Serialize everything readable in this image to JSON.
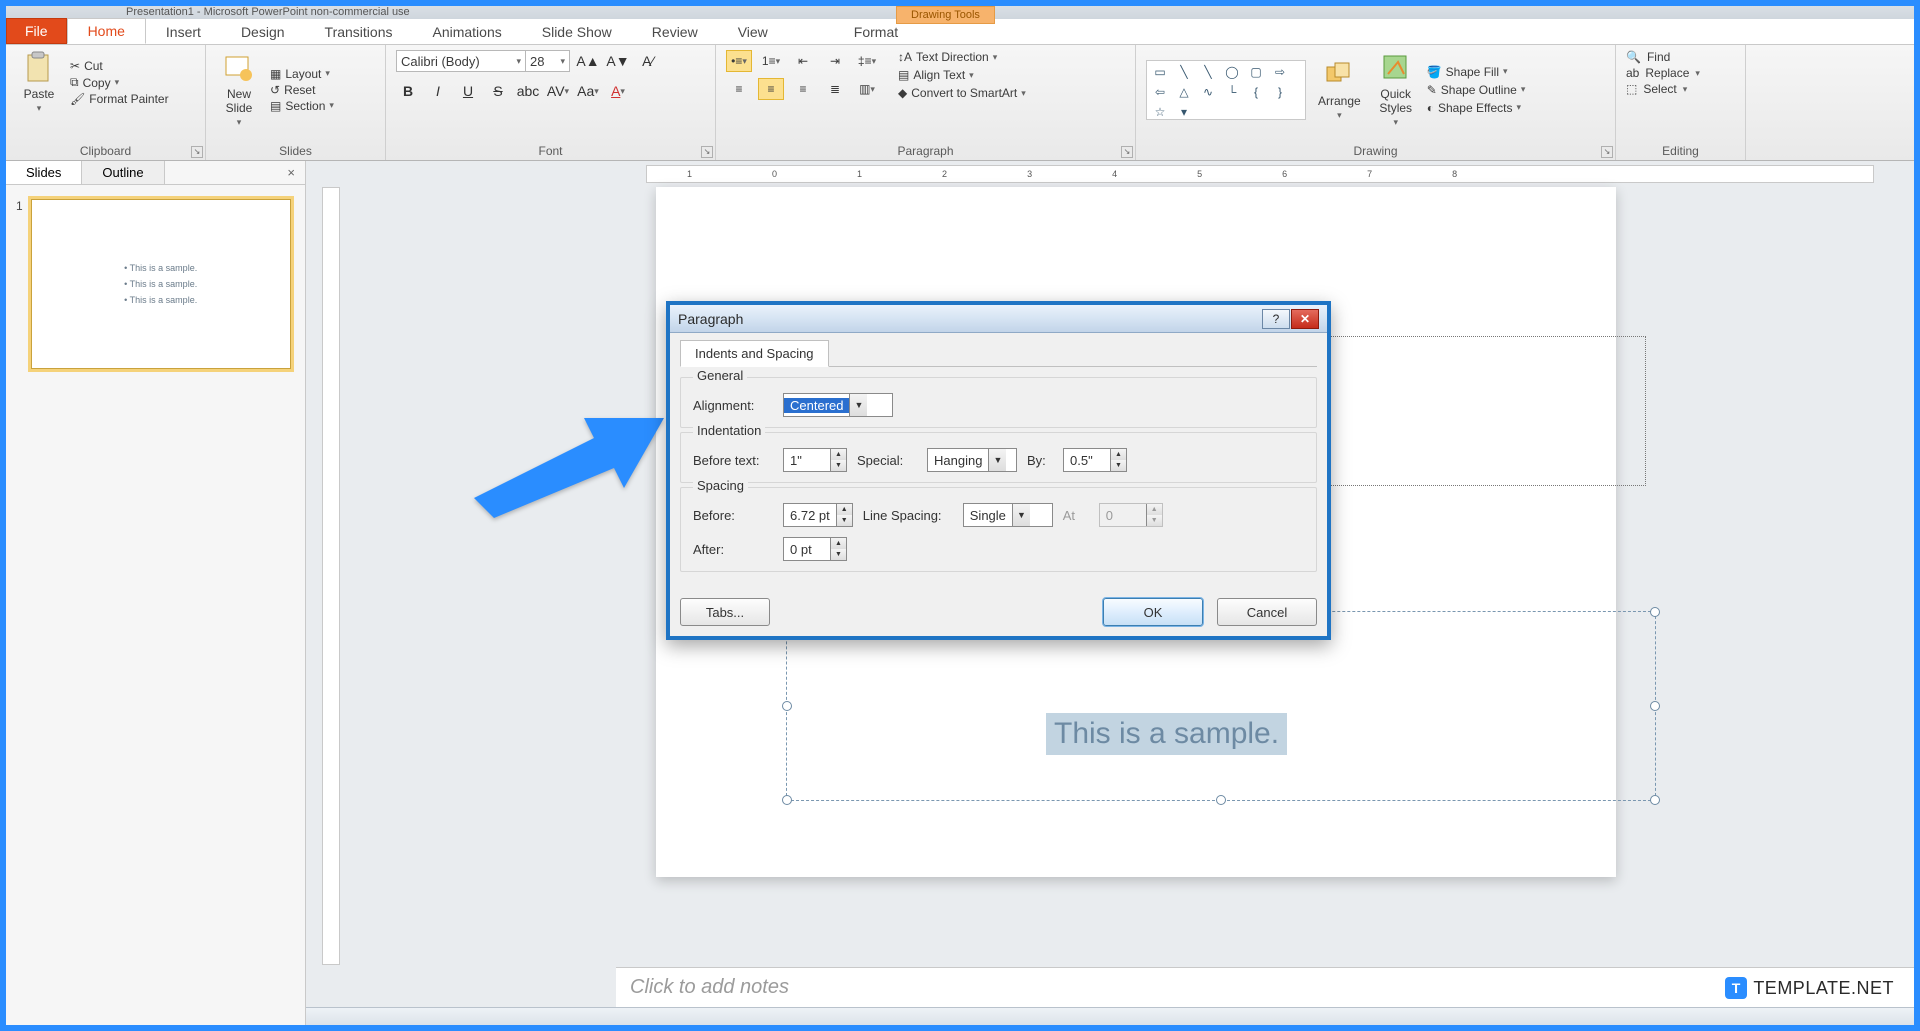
{
  "title_bar": "Presentation1 - Microsoft PowerPoint non-commercial use",
  "tabs": {
    "file": "File",
    "home": "Home",
    "insert": "Insert",
    "design": "Design",
    "transitions": "Transitions",
    "animations": "Animations",
    "slideshow": "Slide Show",
    "review": "Review",
    "view": "View",
    "format": "Format"
  },
  "drawing_tools_header": "Drawing Tools",
  "ribbon": {
    "clipboard": {
      "label": "Clipboard",
      "paste": "Paste",
      "cut": "Cut",
      "copy": "Copy",
      "format_painter": "Format Painter"
    },
    "slides": {
      "label": "Slides",
      "new_slide": "New\nSlide",
      "layout": "Layout",
      "reset": "Reset",
      "section": "Section"
    },
    "font": {
      "label": "Font",
      "name": "Calibri (Body)",
      "size": "28"
    },
    "paragraph": {
      "label": "Paragraph",
      "text_direction": "Text Direction",
      "align_text": "Align Text",
      "smartart": "Convert to SmartArt"
    },
    "drawing": {
      "label": "Drawing",
      "arrange": "Arrange",
      "quick_styles": "Quick\nStyles",
      "shape_fill": "Shape Fill",
      "shape_outline": "Shape Outline",
      "shape_effects": "Shape Effects"
    },
    "editing": {
      "label": "Editing",
      "find": "Find",
      "replace": "Replace",
      "select": "Select"
    }
  },
  "slide_panel": {
    "tabs": {
      "slides": "Slides",
      "outline": "Outline"
    },
    "slide_number": "1",
    "bullets": [
      "This is a sample.",
      "This is a sample.",
      "This is a sample."
    ]
  },
  "ruler_marks": [
    "1",
    "0",
    "1",
    "2",
    "3",
    "4",
    "5",
    "6",
    "7",
    "8"
  ],
  "slide": {
    "sample_text": "This is a sample."
  },
  "notes_placeholder": "Click to add notes",
  "dialog": {
    "title": "Paragraph",
    "tab": "Indents and Spacing",
    "general": {
      "legend": "General",
      "alignment_label": "Alignment:",
      "alignment_value": "Centered"
    },
    "indentation": {
      "legend": "Indentation",
      "before_text_label": "Before text:",
      "before_text_value": "1\"",
      "special_label": "Special:",
      "special_value": "Hanging",
      "by_label": "By:",
      "by_value": "0.5\""
    },
    "spacing": {
      "legend": "Spacing",
      "before_label": "Before:",
      "before_value": "6.72 pt",
      "after_label": "After:",
      "after_value": "0 pt",
      "line_spacing_label": "Line Spacing:",
      "line_spacing_value": "Single",
      "at_label": "At",
      "at_value": "0"
    },
    "buttons": {
      "tabs": "Tabs...",
      "ok": "OK",
      "cancel": "Cancel"
    }
  },
  "watermark": "TEMPLATE.NET"
}
